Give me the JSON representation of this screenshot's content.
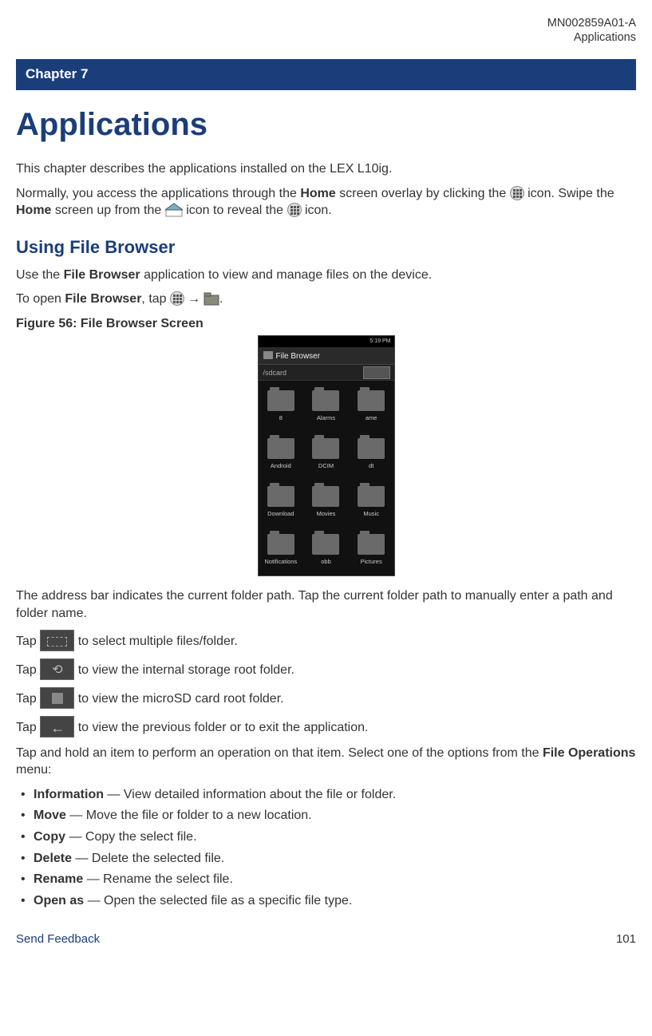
{
  "meta": {
    "doc_id": "MN002859A01-A",
    "section": "Applications"
  },
  "chapter_bar": "Chapter 7",
  "h1": "Applications",
  "intro": "This chapter describes the applications installed on the LEX L10ig.",
  "p2a": "Normally, you access the applications through the ",
  "p2b": " screen overlay by clicking the ",
  "p2c": " icon. Swipe the ",
  "p2d": " screen up from the ",
  "p2e": " icon to reveal the ",
  "p2f": " icon.",
  "home": "Home",
  "h2": "Using File Browser",
  "p3a": "Use the ",
  "file_browser": "File Browser",
  "p3b": " application to view and manage files on the device.",
  "p4a": "To open ",
  "p4b": ", tap ",
  "arrow": "→",
  "period": ".",
  "fig_caption": "Figure 56: File Browser Screen",
  "screenshot": {
    "status_time": "5:19 PM",
    "title": "File Browser",
    "path": "/sdcard",
    "folders": [
      "8",
      "Alarms",
      "ame",
      "Android",
      "DCIM",
      "dt",
      "Download",
      "Movies",
      "Music",
      "Notifications",
      "obb",
      "Pictures"
    ]
  },
  "p5": "The address bar indicates the current folder path. Tap the current folder path to manually enter a path and folder name.",
  "tap": "Tap ",
  "tap_multi": " to select multiple files/folder.",
  "tap_root": " to view the internal storage root folder.",
  "tap_sd": " to view the microSD card root folder.",
  "tap_back": " to view the previous folder or to exit the application.",
  "p6a": "Tap and hold an item to perform an operation on that item. Select one of the options from the ",
  "file_ops": "File Operations",
  "p6b": " menu:",
  "ops": [
    {
      "name": "Information",
      "desc": " — View detailed information about the file or folder."
    },
    {
      "name": "Move",
      "desc": " — Move the file or folder to a new location."
    },
    {
      "name": "Copy",
      "desc": " — Copy the select file."
    },
    {
      "name": "Delete",
      "desc": " — Delete the selected file."
    },
    {
      "name": "Rename",
      "desc": " — Rename the select file."
    },
    {
      "name": "Open as",
      "desc": " — Open the selected file as a specific file type."
    }
  ],
  "footer": {
    "link": "Send Feedback",
    "page": "101"
  }
}
